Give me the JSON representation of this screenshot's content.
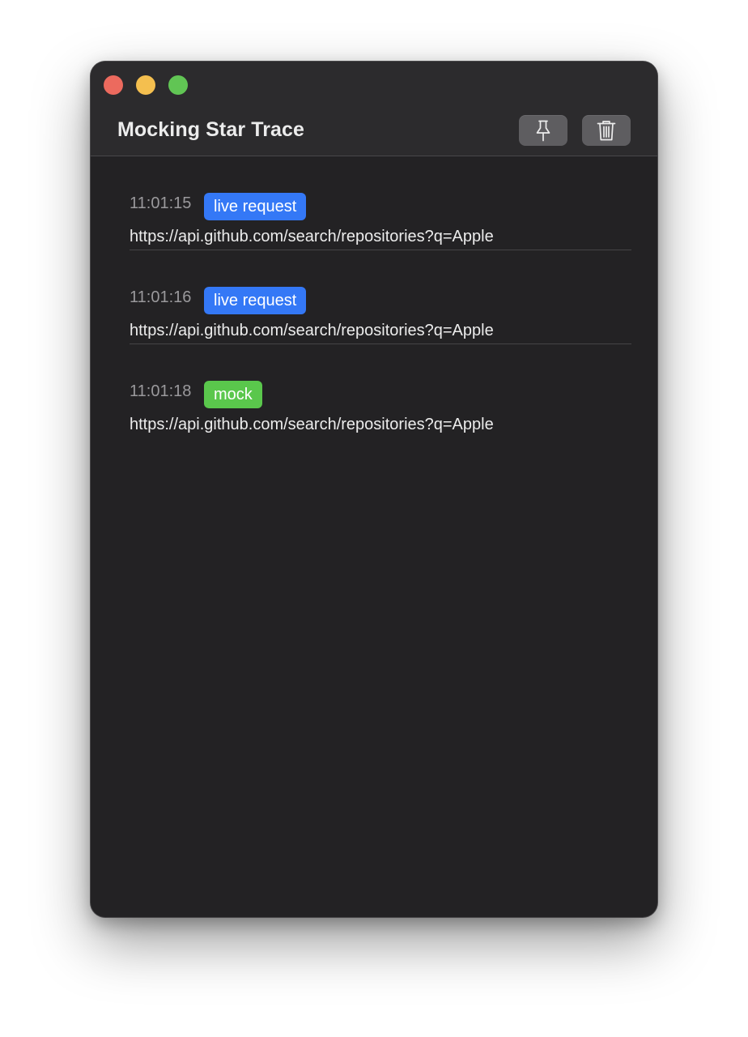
{
  "window": {
    "title": "Mocking Star Trace"
  },
  "toolbar": {
    "pin_icon": "pin-icon",
    "trash_icon": "trash-icon"
  },
  "colors": {
    "live_request": "#3478f6",
    "mock": "#5ac74c"
  },
  "entries": [
    {
      "time": "11:01:15",
      "badge": "live request",
      "badge_type": "live_request",
      "url": "https://api.github.com/search/repositories?q=Apple"
    },
    {
      "time": "11:01:16",
      "badge": "live request",
      "badge_type": "live_request",
      "url": "https://api.github.com/search/repositories?q=Apple"
    },
    {
      "time": "11:01:18",
      "badge": "mock",
      "badge_type": "mock",
      "url": "https://api.github.com/search/repositories?q=Apple"
    }
  ]
}
